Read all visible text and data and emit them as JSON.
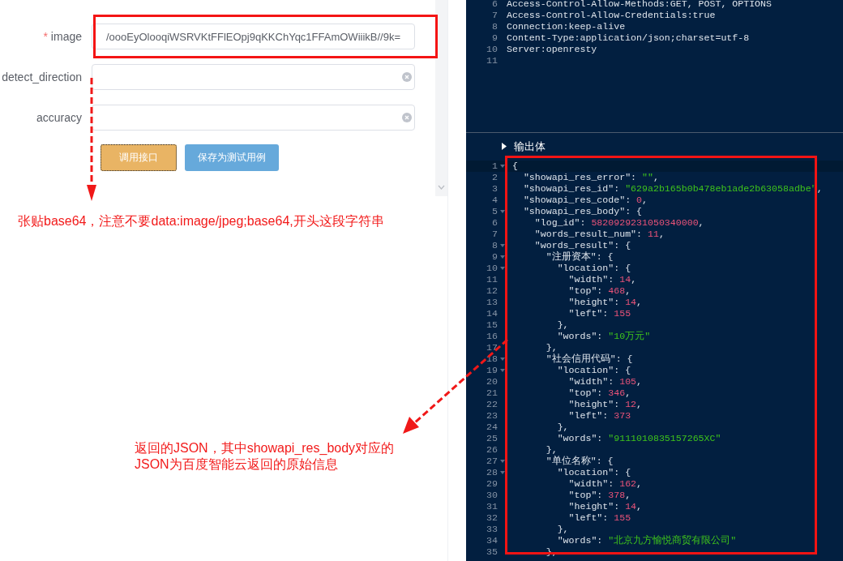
{
  "form": {
    "fields": [
      {
        "label": "image",
        "required_mark": "*",
        "value": "/oooEyOlooqiWSRVKtFFlEOpj9qKKChYqc1FFAmOWiiikB//9k=",
        "clearable": false
      },
      {
        "label": "detect_direction",
        "clearable": true
      },
      {
        "label": "accuracy",
        "clearable": true
      }
    ],
    "buttons": [
      {
        "label": "调用接口",
        "kind": "warning",
        "focused": true
      },
      {
        "label": "保存为测试用例",
        "kind": "primary",
        "focused": false
      }
    ]
  },
  "response_headers": {
    "lines": [
      {
        "number": "6",
        "text": "Access-Control-Allow-Methods:GET, POST, OPTIONS"
      },
      {
        "number": "7",
        "text": "Access-Control-Allow-Credentials:true"
      },
      {
        "number": "8",
        "text": "Connection:keep-alive"
      },
      {
        "number": "9",
        "text": "Content-Type:application/json;charset=utf-8"
      },
      {
        "number": "10",
        "text": "Server:openresty"
      },
      {
        "number": "11"
      }
    ]
  },
  "output": {
    "title": "输出体",
    "expanded": true,
    "lines": [
      {
        "number": "1",
        "foldable": true,
        "active": true,
        "tokens": [
          {
            "kind": "plain",
            "text": "{"
          }
        ]
      },
      {
        "number": "2",
        "foldable": false,
        "active": false,
        "tokens": [
          {
            "kind": "plain",
            "text": "  \"showapi_res_error\": "
          },
          {
            "kind": "string",
            "text": "\"\""
          },
          {
            "kind": "plain",
            "text": ","
          }
        ]
      },
      {
        "number": "3",
        "foldable": false,
        "active": false,
        "tokens": [
          {
            "kind": "plain",
            "text": "  \"showapi_res_id\": "
          },
          {
            "kind": "string",
            "text": "\"629a2b165b0b478eb1ade2b63058adbe\""
          },
          {
            "kind": "plain",
            "text": ","
          }
        ]
      },
      {
        "number": "4",
        "foldable": false,
        "active": false,
        "tokens": [
          {
            "kind": "plain",
            "text": "  \"showapi_res_code\": "
          },
          {
            "kind": "number",
            "text": "0"
          },
          {
            "kind": "plain",
            "text": ","
          }
        ]
      },
      {
        "number": "5",
        "foldable": true,
        "active": false,
        "tokens": [
          {
            "kind": "plain",
            "text": "  \"showapi_res_body\": {"
          }
        ]
      },
      {
        "number": "6",
        "foldable": false,
        "active": false,
        "tokens": [
          {
            "kind": "plain",
            "text": "    \"log_id\": "
          },
          {
            "kind": "number",
            "text": "5820929231050340000"
          },
          {
            "kind": "plain",
            "text": ","
          }
        ]
      },
      {
        "number": "7",
        "foldable": false,
        "active": false,
        "tokens": [
          {
            "kind": "plain",
            "text": "    \"words_result_num\": "
          },
          {
            "kind": "number",
            "text": "11"
          },
          {
            "kind": "plain",
            "text": ","
          }
        ]
      },
      {
        "number": "8",
        "foldable": true,
        "active": false,
        "tokens": [
          {
            "kind": "plain",
            "text": "    \"words_result\": {"
          }
        ]
      },
      {
        "number": "9",
        "foldable": true,
        "active": false,
        "tokens": [
          {
            "kind": "plain",
            "text": "      \"注册资本\": {"
          }
        ]
      },
      {
        "number": "10",
        "foldable": true,
        "active": false,
        "tokens": [
          {
            "kind": "plain",
            "text": "        \"location\": {"
          }
        ]
      },
      {
        "number": "11",
        "foldable": false,
        "active": false,
        "tokens": [
          {
            "kind": "plain",
            "text": "          \"width\": "
          },
          {
            "kind": "number",
            "text": "14"
          },
          {
            "kind": "plain",
            "text": ","
          }
        ]
      },
      {
        "number": "12",
        "foldable": false,
        "active": false,
        "tokens": [
          {
            "kind": "plain",
            "text": "          \"top\": "
          },
          {
            "kind": "number",
            "text": "468"
          },
          {
            "kind": "plain",
            "text": ","
          }
        ]
      },
      {
        "number": "13",
        "foldable": false,
        "active": false,
        "tokens": [
          {
            "kind": "plain",
            "text": "          \"height\": "
          },
          {
            "kind": "number",
            "text": "14"
          },
          {
            "kind": "plain",
            "text": ","
          }
        ]
      },
      {
        "number": "14",
        "foldable": false,
        "active": false,
        "tokens": [
          {
            "kind": "plain",
            "text": "          \"left\": "
          },
          {
            "kind": "number",
            "text": "155"
          }
        ]
      },
      {
        "number": "15",
        "foldable": false,
        "active": false,
        "tokens": [
          {
            "kind": "plain",
            "text": "        },"
          }
        ]
      },
      {
        "number": "16",
        "foldable": false,
        "active": false,
        "tokens": [
          {
            "kind": "plain",
            "text": "        \"words\": "
          },
          {
            "kind": "string",
            "text": "\"10万元\""
          }
        ]
      },
      {
        "number": "17",
        "foldable": false,
        "active": false,
        "tokens": [
          {
            "kind": "plain",
            "text": "      },"
          }
        ]
      },
      {
        "number": "18",
        "foldable": true,
        "active": false,
        "tokens": [
          {
            "kind": "plain",
            "text": "      \"社会信用代码\": {"
          }
        ]
      },
      {
        "number": "19",
        "foldable": true,
        "active": false,
        "tokens": [
          {
            "kind": "plain",
            "text": "        \"location\": {"
          }
        ]
      },
      {
        "number": "20",
        "foldable": false,
        "active": false,
        "tokens": [
          {
            "kind": "plain",
            "text": "          \"width\": "
          },
          {
            "kind": "number",
            "text": "105"
          },
          {
            "kind": "plain",
            "text": ","
          }
        ]
      },
      {
        "number": "21",
        "foldable": false,
        "active": false,
        "tokens": [
          {
            "kind": "plain",
            "text": "          \"top\": "
          },
          {
            "kind": "number",
            "text": "346"
          },
          {
            "kind": "plain",
            "text": ","
          }
        ]
      },
      {
        "number": "22",
        "foldable": false,
        "active": false,
        "tokens": [
          {
            "kind": "plain",
            "text": "          \"height\": "
          },
          {
            "kind": "number",
            "text": "12"
          },
          {
            "kind": "plain",
            "text": ","
          }
        ]
      },
      {
        "number": "23",
        "foldable": false,
        "active": false,
        "tokens": [
          {
            "kind": "plain",
            "text": "          \"left\": "
          },
          {
            "kind": "number",
            "text": "373"
          }
        ]
      },
      {
        "number": "24",
        "foldable": false,
        "active": false,
        "tokens": [
          {
            "kind": "plain",
            "text": "        },"
          }
        ]
      },
      {
        "number": "25",
        "foldable": false,
        "active": false,
        "tokens": [
          {
            "kind": "plain",
            "text": "        \"words\": "
          },
          {
            "kind": "string",
            "text": "\"9111010835157265XC\""
          }
        ]
      },
      {
        "number": "26",
        "foldable": false,
        "active": false,
        "tokens": [
          {
            "kind": "plain",
            "text": "      },"
          }
        ]
      },
      {
        "number": "27",
        "foldable": true,
        "active": false,
        "tokens": [
          {
            "kind": "plain",
            "text": "      \"单位名称\": {"
          }
        ]
      },
      {
        "number": "28",
        "foldable": true,
        "active": false,
        "tokens": [
          {
            "kind": "plain",
            "text": "        \"location\": {"
          }
        ]
      },
      {
        "number": "29",
        "foldable": false,
        "active": false,
        "tokens": [
          {
            "kind": "plain",
            "text": "          \"width\": "
          },
          {
            "kind": "number",
            "text": "162"
          },
          {
            "kind": "plain",
            "text": ","
          }
        ]
      },
      {
        "number": "30",
        "foldable": false,
        "active": false,
        "tokens": [
          {
            "kind": "plain",
            "text": "          \"top\": "
          },
          {
            "kind": "number",
            "text": "378"
          },
          {
            "kind": "plain",
            "text": ","
          }
        ]
      },
      {
        "number": "31",
        "foldable": false,
        "active": false,
        "tokens": [
          {
            "kind": "plain",
            "text": "          \"height\": "
          },
          {
            "kind": "number",
            "text": "14"
          },
          {
            "kind": "plain",
            "text": ","
          }
        ]
      },
      {
        "number": "32",
        "foldable": false,
        "active": false,
        "tokens": [
          {
            "kind": "plain",
            "text": "          \"left\": "
          },
          {
            "kind": "number",
            "text": "155"
          }
        ]
      },
      {
        "number": "33",
        "foldable": false,
        "active": false,
        "tokens": [
          {
            "kind": "plain",
            "text": "        },"
          }
        ]
      },
      {
        "number": "34",
        "foldable": false,
        "active": false,
        "tokens": [
          {
            "kind": "plain",
            "text": "        \"words\": "
          },
          {
            "kind": "string",
            "text": "\"北京九方愉悦商贸有限公司\""
          }
        ]
      },
      {
        "number": "35",
        "foldable": false,
        "active": false,
        "tokens": [
          {
            "kind": "plain",
            "text": "      },"
          }
        ]
      }
    ]
  },
  "annotations": [
    {
      "text": "张贴base64，注意不要data:image/jpeg;base64,开头这段字符串"
    },
    {
      "text": "返回的JSON，其中showapi_res_body对应的JSON为百度智能云返回的原始信息"
    }
  ]
}
